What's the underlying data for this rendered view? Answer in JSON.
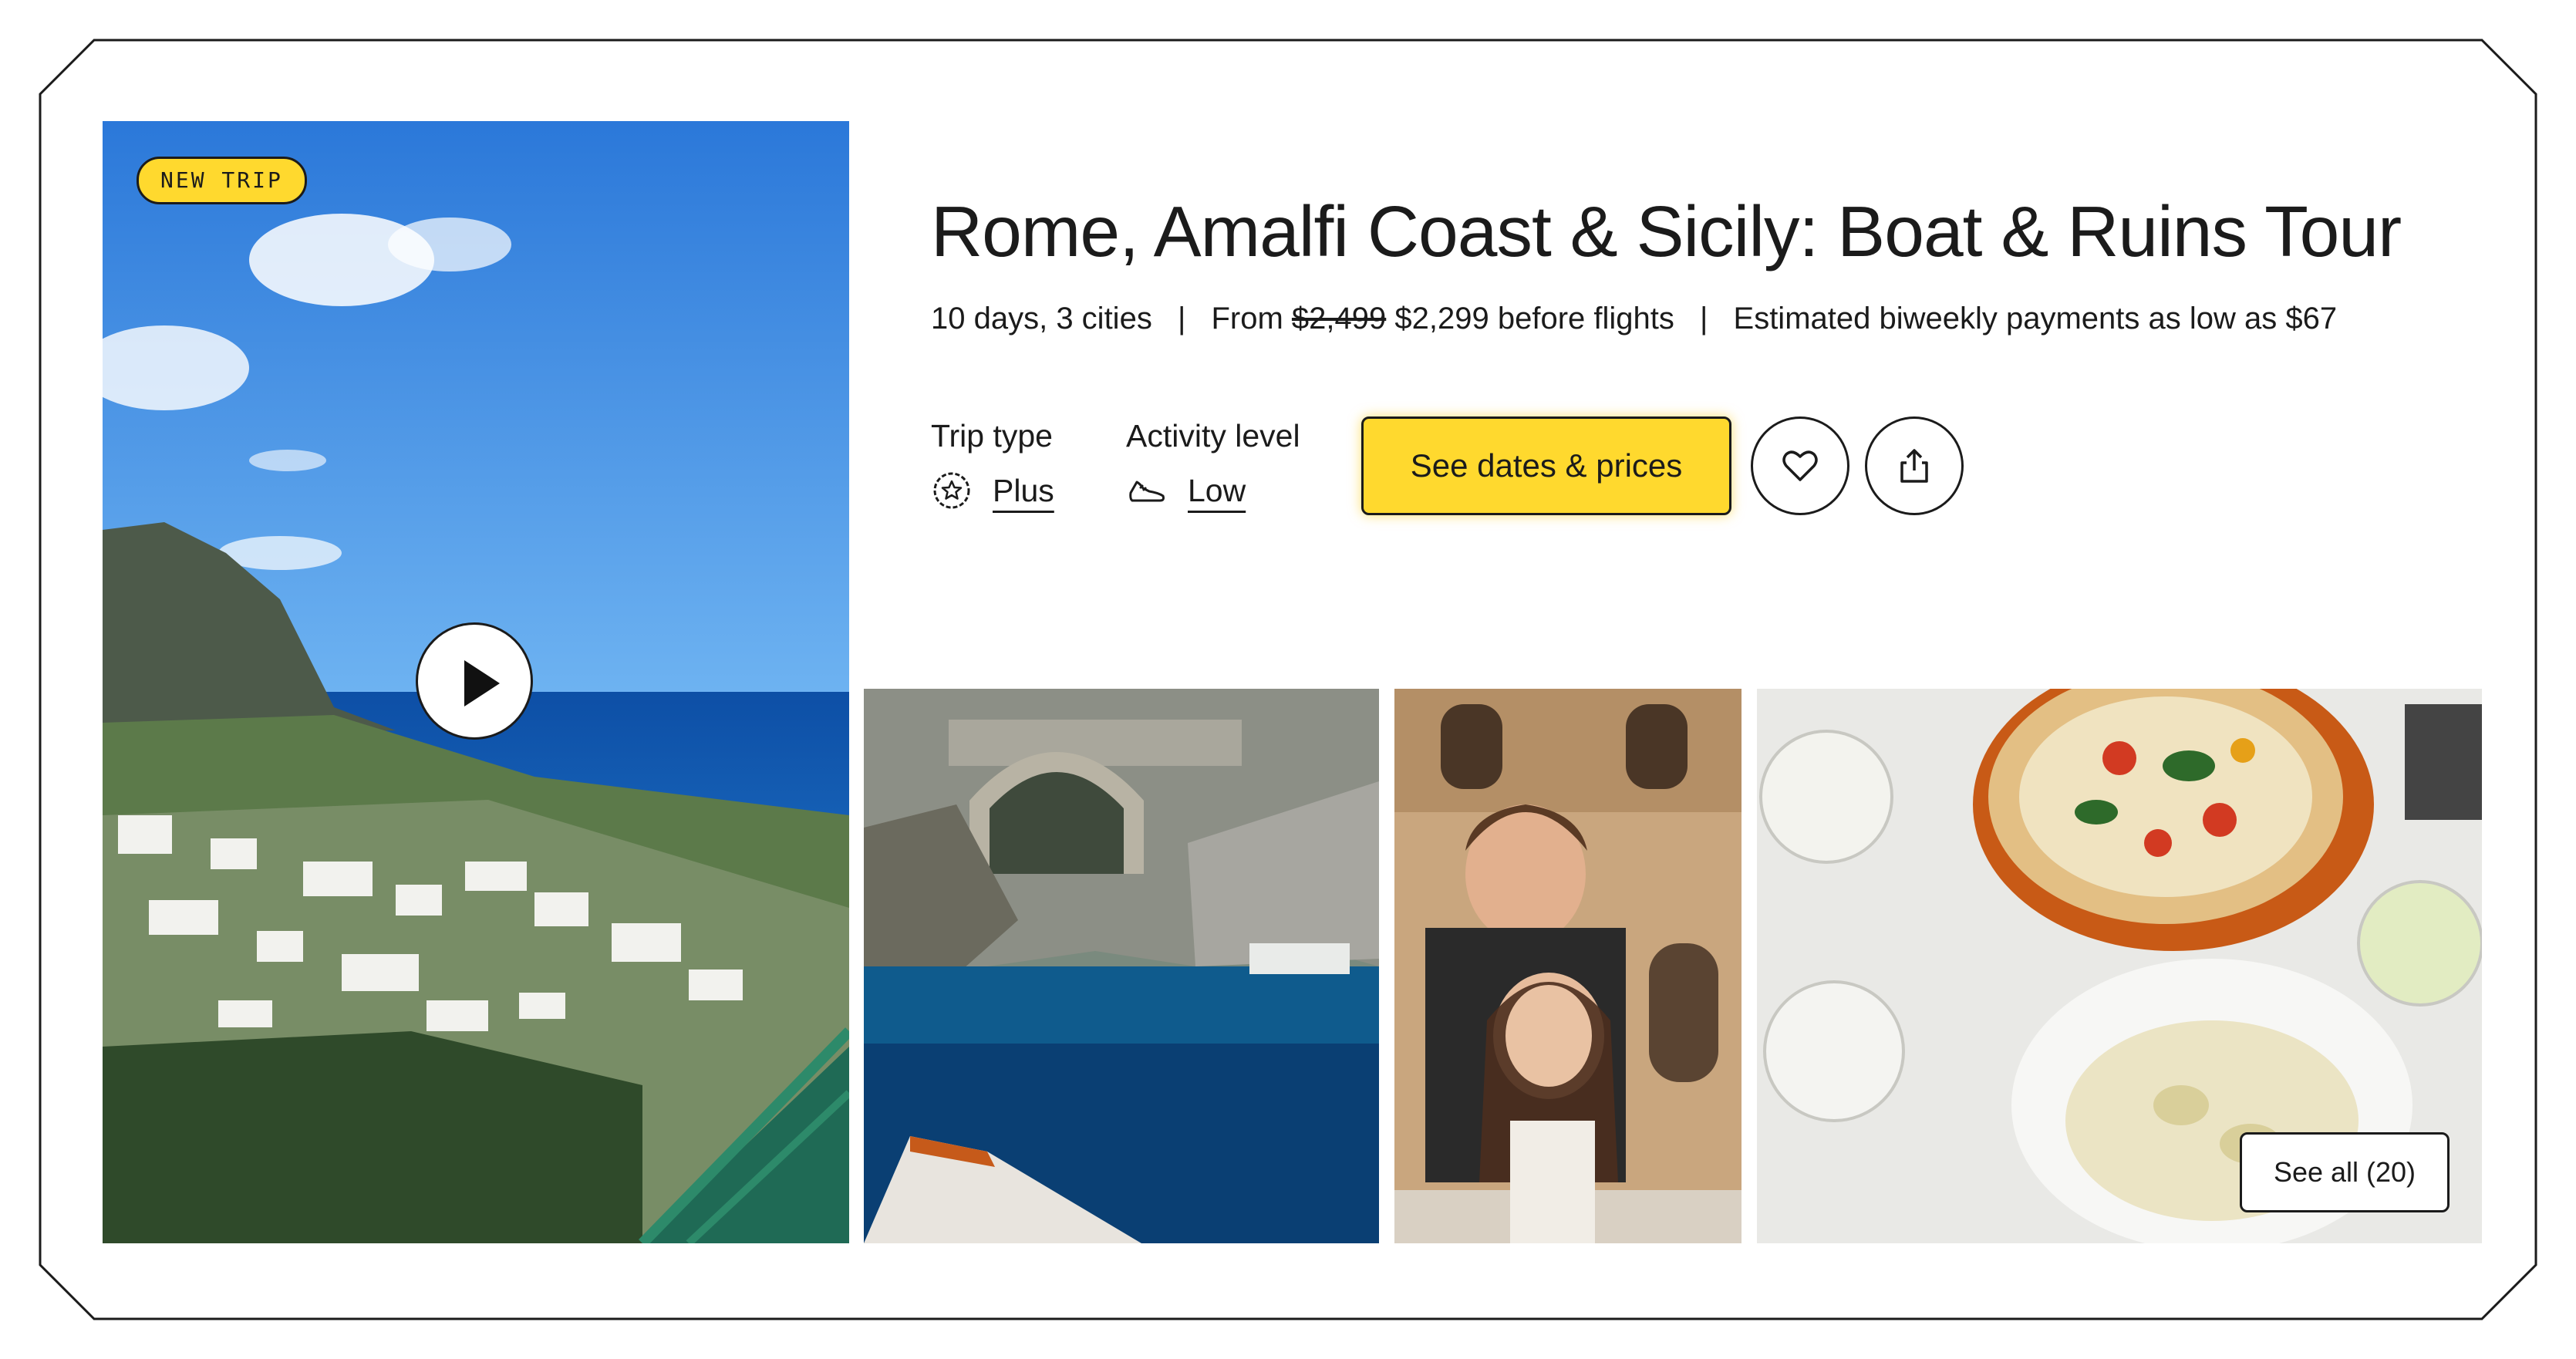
{
  "badge": "NEW TRIP",
  "trip": {
    "title": "Rome, Amalfi Coast & Sicily: Boat & Ruins Tour",
    "duration": "10 days, 3 cities",
    "from_label": "From",
    "old_price": "$2,499",
    "price_text": "$2,299 before flights",
    "payments": "Estimated biweekly payments as low as $67"
  },
  "attributes": {
    "trip_type_label": "Trip type",
    "trip_type_value": "Plus",
    "activity_label": "Activity level",
    "activity_value": "Low"
  },
  "actions": {
    "cta": "See dates & prices",
    "see_all": "See all (20)"
  },
  "colors": {
    "accent": "#ffd92e",
    "ink": "#1b1b1b"
  },
  "icons": [
    "play-icon",
    "star-badge-icon",
    "shoe-icon",
    "heart-icon",
    "share-icon"
  ]
}
